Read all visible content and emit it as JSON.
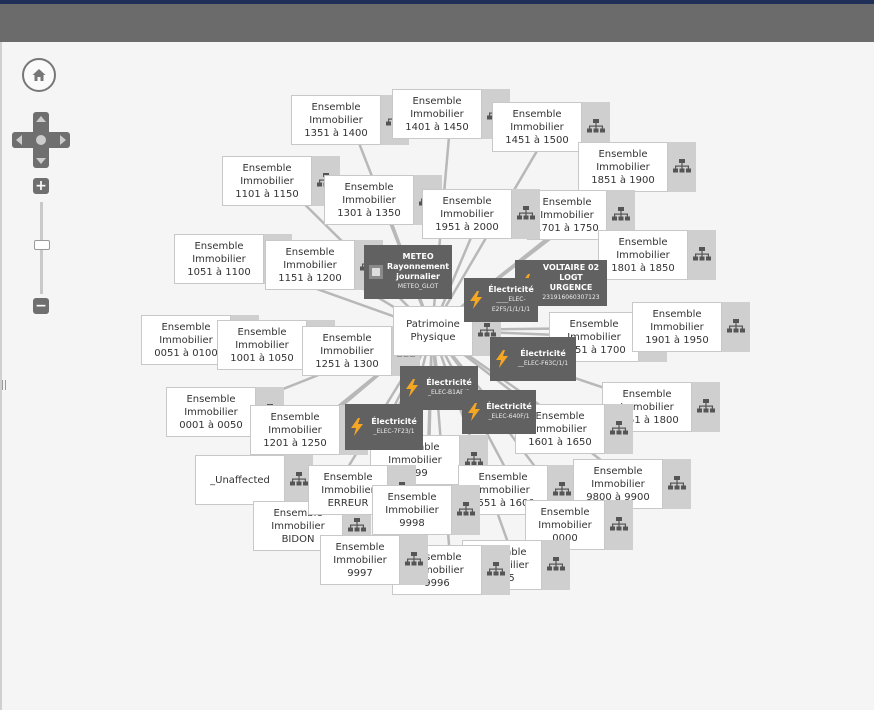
{
  "colors": {
    "topbar": "#6b6b6b",
    "accent": "#1f2f57",
    "node_icon_bg": "#cfcfcf",
    "dark_node": "#616161",
    "bolt": "#f5a623",
    "edge": "#b8b8b8"
  },
  "controls": {
    "home_icon": "home-icon",
    "pan_icon": "pan-arrows-icon",
    "zoom_in": "+",
    "zoom_out": "−",
    "zoom_level": 0.58
  },
  "nodes": [
    {
      "id": "n0051",
      "lines": [
        "Ensemble",
        "Immobilier",
        "0051 à 0100"
      ]
    },
    {
      "id": "n0001",
      "lines": [
        "Ensemble",
        "Immobilier",
        "0001 à 0050"
      ]
    },
    {
      "id": "nunaff",
      "lines": [
        "_Unaffected"
      ]
    },
    {
      "id": "nbidon",
      "lines": [
        "Ensemble",
        "Immobilier",
        "BIDON"
      ]
    },
    {
      "id": "n1351",
      "lines": [
        "Ensemble",
        "Immobilier",
        "1351 à 1400"
      ]
    },
    {
      "id": "n1401",
      "lines": [
        "Ensemble",
        "Immobilier",
        "1401 à 1450"
      ]
    },
    {
      "id": "n1451",
      "lines": [
        "Ensemble",
        "Immobilier",
        "1451 à 1500"
      ]
    },
    {
      "id": "n1851",
      "lines": [
        "Ensemble",
        "Immobilier",
        "1851 à 1900"
      ]
    },
    {
      "id": "n1101",
      "lines": [
        "Ensemble",
        "Immobilier",
        "1101 à 1150"
      ]
    },
    {
      "id": "n1301",
      "lines": [
        "Ensemble",
        "Immobilier",
        "1301 à 1350"
      ]
    },
    {
      "id": "n1701",
      "lines": [
        "Ensemble",
        "Immobilier",
        "1701 à 1750"
      ]
    },
    {
      "id": "n1951",
      "lines": [
        "Ensemble",
        "Immobilier",
        "1951 à 2000"
      ]
    },
    {
      "id": "n1801",
      "lines": [
        "Ensemble",
        "Immobilier",
        "1801 à 1850"
      ]
    },
    {
      "id": "n1051",
      "lines": [
        "Ensemble",
        "Immobilier",
        "1051 à 1100"
      ]
    },
    {
      "id": "n1151",
      "lines": [
        "Ensemble",
        "Immobilier",
        "1151 à 1200"
      ]
    },
    {
      "id": "n1001",
      "lines": [
        "Ensemble",
        "Immobilier",
        "1001 à 1050"
      ]
    },
    {
      "id": "n1651",
      "lines": [
        "Ensemble",
        "Immobilier",
        "1651 à 1700"
      ]
    },
    {
      "id": "n1901",
      "lines": [
        "Ensemble",
        "Immobilier",
        "1901 à 1950"
      ]
    },
    {
      "id": "n1251",
      "lines": [
        "Ensemble",
        "Immobilier",
        "1251 à 1300"
      ]
    },
    {
      "id": "npatr",
      "lines": [
        "Patrimoine",
        "Physique"
      ]
    },
    {
      "id": "n1751",
      "lines": [
        "Ensemble",
        "Immobilier",
        "1751 à 1800"
      ]
    },
    {
      "id": "n1201",
      "lines": [
        "Ensemble",
        "Immobilier",
        "1201 à 1250"
      ]
    },
    {
      "id": "n1601",
      "lines": [
        "Ensemble",
        "Immobilier",
        "1601 à 1650"
      ]
    },
    {
      "id": "n9999",
      "lines": [
        "Ensemble",
        "Immobilier",
        "9999"
      ]
    },
    {
      "id": "n1551",
      "lines": [
        "Ensemble",
        "Immobilier",
        "1551 à 1600"
      ]
    },
    {
      "id": "n9800",
      "lines": [
        "Ensemble",
        "Immobilier",
        "9800 à 9900"
      ]
    },
    {
      "id": "nerreur",
      "lines": [
        "Ensemble",
        "Immobilier",
        "ERREUR"
      ]
    },
    {
      "id": "n9998",
      "lines": [
        "Ensemble",
        "Immobilier",
        "9998"
      ]
    },
    {
      "id": "n0000",
      "lines": [
        "Ensemble",
        "Immobilier",
        "0000"
      ]
    },
    {
      "id": "n9995",
      "lines": [
        "Ensemble",
        "Immobilier",
        "9995"
      ]
    },
    {
      "id": "n9996",
      "lines": [
        "Ensemble",
        "Immobilier",
        "9996"
      ]
    },
    {
      "id": "n9997",
      "lines": [
        "Ensemble",
        "Immobilier",
        "9997"
      ]
    }
  ],
  "dark_nodes": [
    {
      "id": "dmeteo",
      "title": [
        "METEO",
        "Rayonnement",
        "journalier"
      ],
      "sub": "METEO_GLOT",
      "icon": "sensor-icon"
    },
    {
      "id": "dvolt",
      "title": [
        "VOLTAIRE 02",
        "LOGT URGENCE"
      ],
      "sub": "231916060307123",
      "icon": "bolt-icon"
    },
    {
      "id": "de1",
      "title": [
        "Électricité"
      ],
      "sub": "____ELEC-E2F5/1/1/1/1",
      "icon": "bolt-icon"
    },
    {
      "id": "de2",
      "title": [
        "Électricité"
      ],
      "sub": "__ELEC-F63C/1/1",
      "icon": "bolt-icon"
    },
    {
      "id": "de3",
      "title": [
        "Électricité"
      ],
      "sub": "_ELEC-B1AB/1",
      "icon": "bolt-icon"
    },
    {
      "id": "de4",
      "title": [
        "Électricité"
      ],
      "sub": "_ELEC-640F/1",
      "icon": "bolt-icon"
    },
    {
      "id": "de5",
      "title": [
        "Électricité"
      ],
      "sub": "_ELEC-7F23/1",
      "icon": "bolt-icon"
    }
  ]
}
